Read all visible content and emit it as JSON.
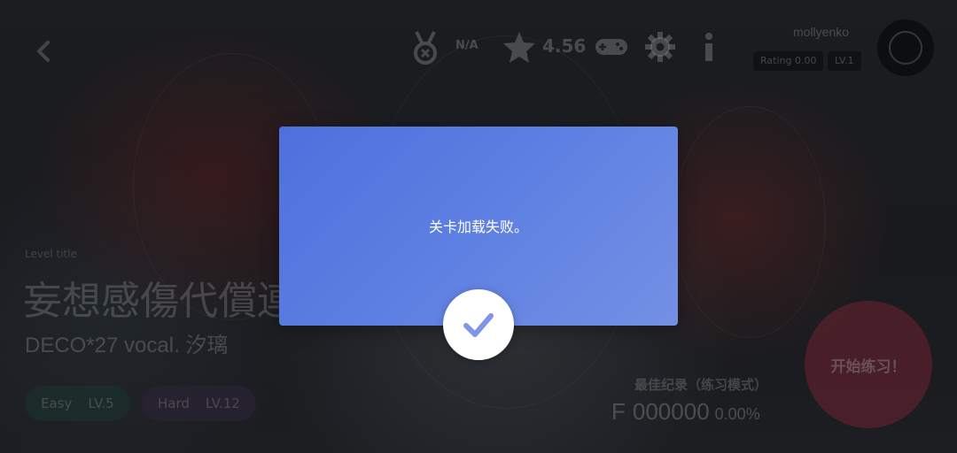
{
  "topbar": {
    "medal_status": "N/A",
    "rating": "4.56",
    "username": "mollyenko",
    "badges": [
      "Rating 0.00",
      "LV.1"
    ]
  },
  "song": {
    "label": "Level title",
    "title": "妄想感傷代償連盟",
    "artist": "DECO*27 vocal. 汐璃",
    "difficulties": [
      {
        "name": "Easy",
        "level": "LV.5"
      },
      {
        "name": "Hard",
        "level": "LV.12"
      }
    ]
  },
  "best_record": {
    "label": "最佳纪录（练习模式）",
    "grade": "F",
    "score": "000000",
    "accuracy": "0.00%"
  },
  "start_button": {
    "label": "开始练习！"
  },
  "dialog": {
    "message": "关卡加载失败。"
  },
  "colors": {
    "dialog_start": "#4d70dd",
    "dialog_end": "#7390e4",
    "check": "#7f96e6",
    "start_button": "#aa374b"
  },
  "icons": [
    "back-arrow-icon",
    "medal-icon",
    "star-icon",
    "gamepad-icon",
    "gear-icon",
    "info-icon",
    "checkmark-icon"
  ]
}
